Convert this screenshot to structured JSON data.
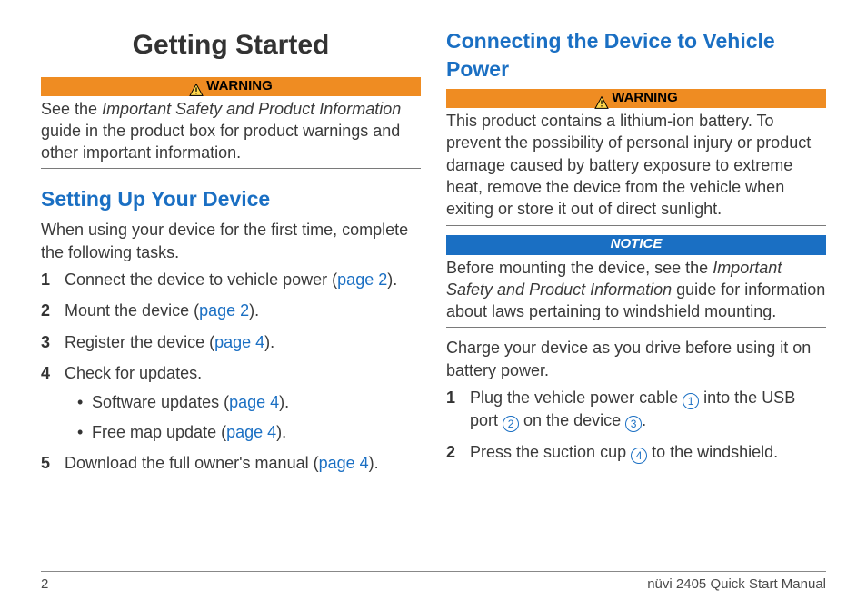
{
  "left": {
    "title": "Getting Started",
    "warn_label": "WARNING",
    "warn_text_pre": "See the ",
    "warn_text_em": "Important Safety and Product Information",
    "warn_text_post": " guide in the product box for product warnings and other important information.",
    "setup_heading": "Setting Up Your Device",
    "setup_intro": "When using your device for the first time, complete the following tasks.",
    "step1_pre": "Connect the device to vehicle power (",
    "step1_link": "page 2",
    "step1_post": ").",
    "step2_pre": "Mount the device (",
    "step2_link": "page 2",
    "step2_post": ").",
    "step3_pre": "Register the device (",
    "step3_link": "page 4",
    "step3_post": ").",
    "step4_text": "Check for updates.",
    "step4_sub1_pre": "Software updates (",
    "step4_sub1_link": "page 4",
    "step4_sub1_post": ").",
    "step4_sub2_pre": "Free map update (",
    "step4_sub2_link": "page 4",
    "step4_sub2_post": ").",
    "step5_pre": "Download the full owner's manual (",
    "step5_link": "page 4",
    "step5_post": ")."
  },
  "right": {
    "connect_heading": "Connecting the Device to Vehicle Power",
    "warn_label": "WARNING",
    "warn_text": "This product contains a lithium-ion battery. To prevent the possibility of personal injury or product damage caused by battery exposure to extreme heat, remove the device from the vehicle when exiting or store it out of direct sunlight.",
    "notice_label": "NOTICE",
    "notice_text_pre": "Before mounting the device, see the ",
    "notice_text_em": "Important Safety and Product Information",
    "notice_text_post": " guide for information about laws pertaining to windshield mounting.",
    "charge_text": "Charge your device as you drive before using it on battery power.",
    "r_step1_a": "Plug the vehicle power cable ",
    "r_step1_b": " into the USB port ",
    "r_step1_c": " on the device ",
    "r_step1_d": ".",
    "circ1": "1",
    "circ2": "2",
    "circ3": "3",
    "circ4": "4",
    "r_step2_a": "Press the suction cup ",
    "r_step2_b": " to the windshield."
  },
  "footer": {
    "page": "2",
    "title": "nüvi 2405 Quick Start Manual"
  }
}
